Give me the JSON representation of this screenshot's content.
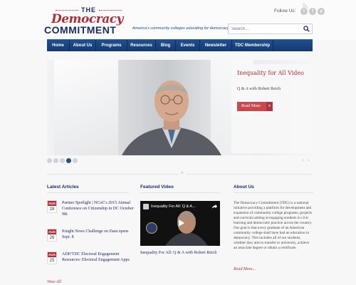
{
  "header": {
    "logo_the": "THE",
    "logo_democracy": "Democracy",
    "logo_commitment": "COMMITMENT",
    "tagline": "America's community colleges educating for democracy.",
    "follow_label": "Follow Us:",
    "social": [
      "t",
      "f",
      "y"
    ],
    "search_placeholder": "Search...",
    "accent": "#b22b35",
    "brand_blue": "#1b2d63"
  },
  "nav": {
    "items": [
      {
        "label": "Home"
      },
      {
        "label": "About Us"
      },
      {
        "label": "Programs"
      },
      {
        "label": "Resources"
      },
      {
        "label": "Blog"
      },
      {
        "label": "Events"
      },
      {
        "label": "Newsletter"
      },
      {
        "label": "TDC Membership"
      }
    ]
  },
  "slider": {
    "title": "Inequality for All Video",
    "subtitle": "Q & A with Robert Reich",
    "button_label": "Read More",
    "slide_count": 5,
    "active_slide": 4
  },
  "latest": {
    "heading": "Latest Articles",
    "articles": [
      {
        "month": "AUG",
        "day": "28",
        "title": "Partner Spotlight | NCoC's 2015 Annual Conference on Citizenship in DC October 9th"
      },
      {
        "month": "AUG",
        "day": "26",
        "title": "Knight News Challenge on Data opens Sept. 8"
      },
      {
        "month": "AUG",
        "day": "25",
        "title": "ADP/TDC Electoral Engagement Resources: Electoral Engagement Apps"
      }
    ],
    "view_all": "View All"
  },
  "featured": {
    "heading": "Featured Video",
    "video_title": "Inequality For All: Q & A...",
    "caption": "Inequality For All: Q & A with Robert Reich"
  },
  "about": {
    "heading": "About Us",
    "text": "The Democracy Commitment (TDC) is a national initiative providing a platform for development and expansion of community college programs, projects and curricula aiming at engaging students in civic learning and democratic practice across the country. Our goal is that every graduate of an American community college shall have had an education in democracy. This includes all of our students, whether they aim to transfer to university, achieve an associate degree or obtain a certificate.",
    "read_more": "Read More..."
  }
}
